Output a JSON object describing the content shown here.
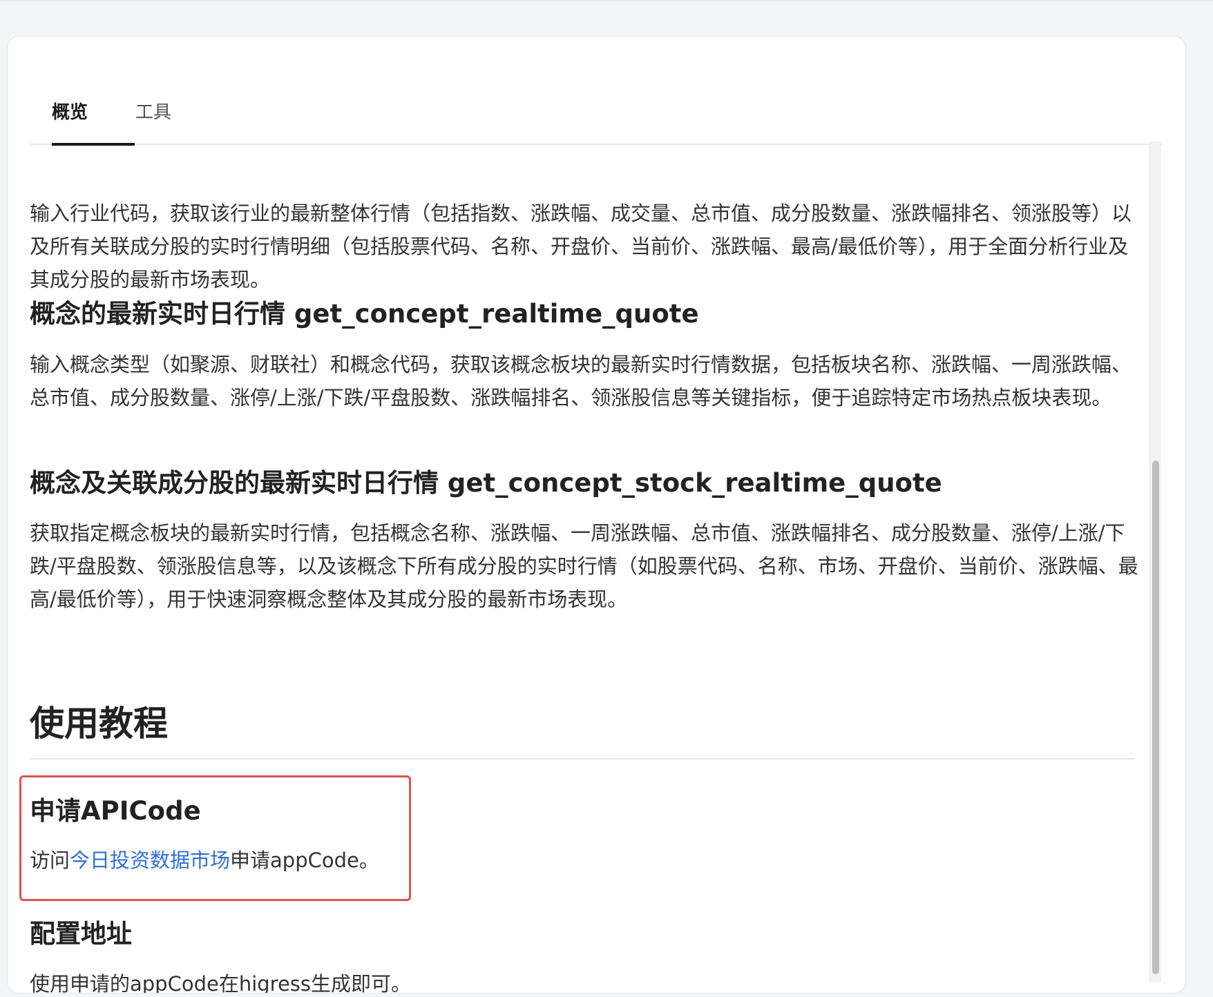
{
  "tabs": [
    {
      "label": "概览",
      "active": true
    },
    {
      "label": "工具",
      "active": false
    }
  ],
  "intro_text": "输入行业代码，获取该行业的最新整体行情（包括指数、涨跌幅、成交量、总市值、成分股数量、涨跌幅排名、领涨股等）以及所有关联成分股的实时行情明细（包括股票代码、名称、开盘价、当前价、涨跌幅、最高/最低价等），用于全面分析行业及其成分股的最新市场表现。",
  "functions": [
    {
      "title": "概念的最新实时日行情 get_concept_realtime_quote",
      "desc": "输入概念类型（如聚源、财联社）和概念代码，获取该概念板块的最新实时行情数据，包括板块名称、涨跌幅、一周涨跌幅、总市值、成分股数量、涨停/上涨/下跌/平盘股数、涨跌幅排名、领涨股信息等关键指标，便于追踪特定市场热点板块表现。"
    },
    {
      "title": "概念及关联成分股的最新实时日行情 get_concept_stock_realtime_quote",
      "desc": "获取指定概念板块的最新实时行情，包括概念名称、涨跌幅、一周涨跌幅、总市值、涨跌幅排名、成分股数量、涨停/上涨/下跌/平盘股数、领涨股信息等，以及该概念下所有成分股的实时行情（如股票代码、名称、市场、开盘价、当前价、涨跌幅、最高/最低价等），用于快速洞察概念整体及其成分股的最新市场表现。"
    }
  ],
  "tutorial": {
    "heading": "使用教程",
    "apply": {
      "title": "申请APICode",
      "text_before": "访问",
      "link_text": "今日投资数据市场",
      "text_after": "申请appCode。"
    },
    "config": {
      "title": "配置地址",
      "text": "使用申请的appCode在higress生成即可。"
    }
  },
  "colors": {
    "link": "#2f6fd6",
    "highlight_border": "#e0504f",
    "active_tab": "#1a1a1a"
  }
}
